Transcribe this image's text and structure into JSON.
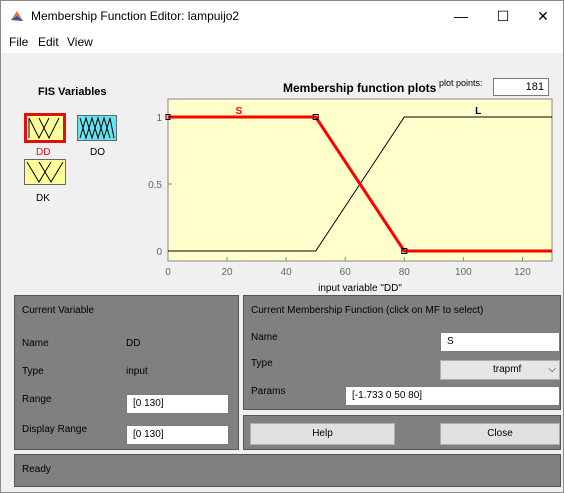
{
  "window": {
    "title": "Membership Function Editor: lampuijo2",
    "minimize": "—",
    "maximize": "☐",
    "close": "✕"
  },
  "menu": [
    "File",
    "Edit",
    "View"
  ],
  "fis": {
    "title": "FIS Variables",
    "variables": [
      {
        "name": "DD",
        "kind": "input",
        "selected": true
      },
      {
        "name": "DO",
        "kind": "output",
        "selected": false
      },
      {
        "name": "DK",
        "kind": "input",
        "selected": false
      }
    ]
  },
  "plot": {
    "title": "Membership function plots",
    "points_label": "plot points:",
    "points_value": "181"
  },
  "chart_data": {
    "type": "line",
    "xlabel": "input variable \"DD\"",
    "xlim": [
      0,
      130
    ],
    "ylim": [
      0,
      1
    ],
    "xticks": [
      "0",
      "20",
      "40",
      "60",
      "80",
      "100",
      "120"
    ],
    "yticks": [
      "0",
      "0.5",
      "1"
    ],
    "series": [
      {
        "name": "S",
        "type": "trapmf",
        "params": [
          -1.733,
          0,
          50,
          80
        ],
        "x": [
          0,
          50,
          80,
          130
        ],
        "y": [
          1,
          1,
          0,
          0
        ],
        "selected": true,
        "label_x": 24
      },
      {
        "name": "L",
        "x": [
          0,
          50,
          80,
          130
        ],
        "y": [
          0,
          0,
          1,
          1
        ],
        "selected": false,
        "label_x": 105
      }
    ]
  },
  "colors": {
    "selected_mf": "#ff0000",
    "mf": "#000000",
    "plot_bg": "#ffffcc",
    "input_var": "#ffff99",
    "output_var": "#66e5f0",
    "panel": "#808080"
  },
  "current_variable": {
    "header": "Current Variable",
    "name_label": "Name",
    "name_value": "DD",
    "type_label": "Type",
    "type_value": "input",
    "range_label": "Range",
    "range_value": "[0 130]",
    "display_range_label": "Display Range",
    "display_range_value": "[0 130]"
  },
  "current_mf": {
    "header": "Current Membership Function (click on MF to select)",
    "name_label": "Name",
    "name_value": "S",
    "type_label": "Type",
    "type_value": "trapmf",
    "params_label": "Params",
    "params_value": "[-1.733 0 50 80]"
  },
  "buttons": {
    "help": "Help",
    "close": "Close"
  },
  "status": "Ready"
}
